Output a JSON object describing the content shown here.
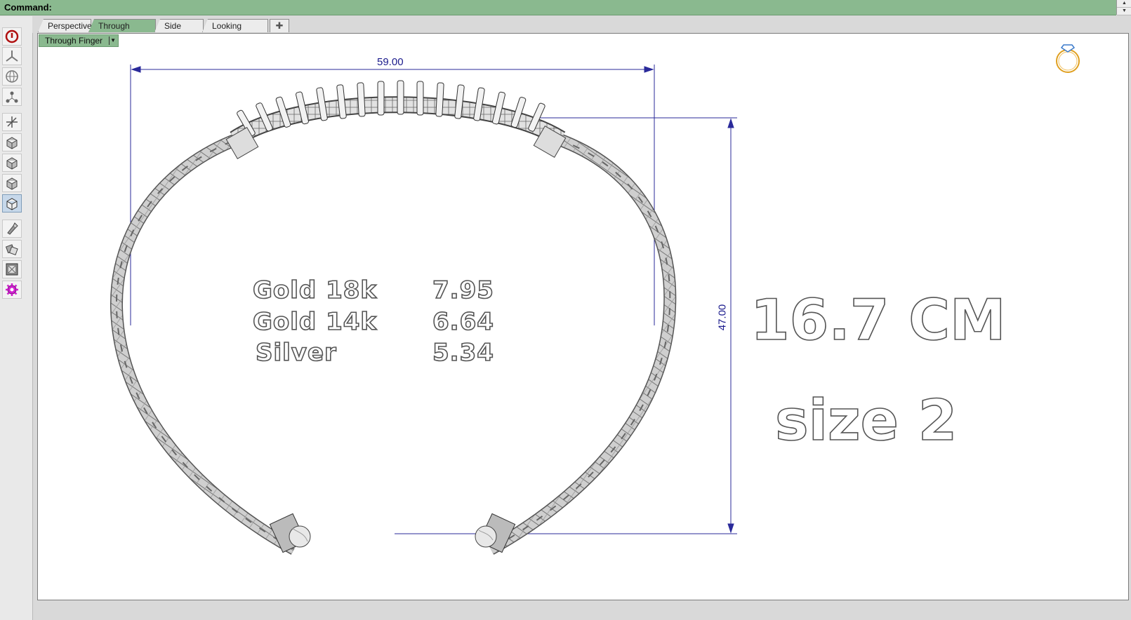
{
  "command_bar": {
    "label": "Command:"
  },
  "sidebar": {
    "tools": [
      {
        "icon": "power-icon"
      },
      {
        "icon": "construction-plane-icon"
      },
      {
        "icon": "globe-icon"
      },
      {
        "icon": "nodes-icon"
      },
      {
        "icon": "axes-icon"
      },
      {
        "icon": "box-view-icon"
      },
      {
        "icon": "box-view-icon"
      },
      {
        "icon": "box-view-icon"
      },
      {
        "icon": "box-view-active-icon"
      },
      {
        "icon": "paint-icon"
      },
      {
        "icon": "shading-icon"
      },
      {
        "icon": "render-icon"
      },
      {
        "icon": "settings-gear-icon"
      }
    ]
  },
  "tabs": [
    {
      "label": "Perspective",
      "selected": false
    },
    {
      "label": "Through Finger",
      "selected": true
    },
    {
      "label": "Side View",
      "selected": false
    },
    {
      "label": "Looking Down",
      "selected": false
    }
  ],
  "tab_add_symbol": "✚",
  "viewport": {
    "label": "Through Finger",
    "dim_width": "59.00",
    "dim_height": "47.00",
    "weights": [
      {
        "metal": "Gold 18k",
        "value": "7.95"
      },
      {
        "metal": "Gold 14k",
        "value": "6.64"
      },
      {
        "metal": "Silver",
        "value": "5.34"
      }
    ],
    "length_text": "16.7 CM",
    "size_text": "size 2"
  },
  "colors": {
    "accent": "#8ab98f",
    "dimension": "#1a1a8c",
    "ring_icon": "#e0a020"
  }
}
